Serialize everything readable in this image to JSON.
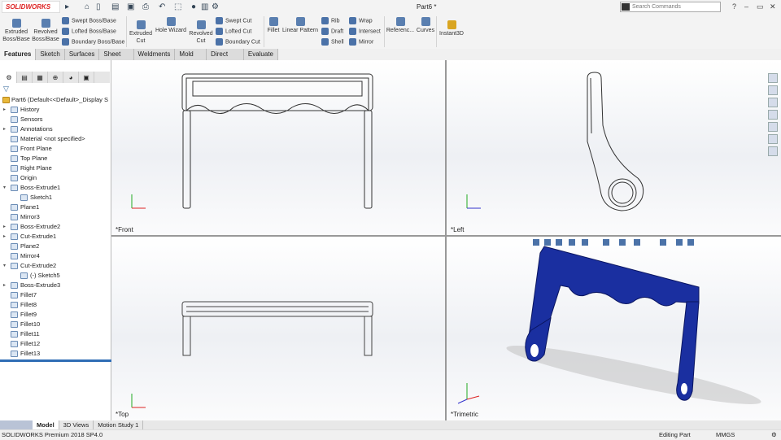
{
  "app": {
    "logo": "SOLIDWORKS",
    "doc_title": "Part6 *",
    "search_placeholder": "Search Commands"
  },
  "ribbon": {
    "extruded_boss": "Extruded Boss/Base",
    "revolved_boss": "Revolved Boss/Base",
    "swept_boss": "Swept Boss/Base",
    "lofted_boss": "Lofted Boss/Base",
    "boundary_boss": "Boundary Boss/Base",
    "extruded_cut": "Extruded Cut",
    "hole_wizard": "Hole Wizard",
    "revolved_cut": "Revolved Cut",
    "swept_cut": "Swept Cut",
    "lofted_cut": "Lofted Cut",
    "boundary_cut": "Boundary Cut",
    "fillet": "Fillet",
    "linear_pattern": "Linear Pattern",
    "rib": "Rib",
    "draft": "Draft",
    "shell": "Shell",
    "wrap": "Wrap",
    "intersect": "Intersect",
    "mirror": "Mirror",
    "reference": "Referenc...",
    "curves": "Curves",
    "instant3d": "Instant3D"
  },
  "tabs": [
    "Features",
    "Sketch",
    "Surfaces",
    "Sheet Metal",
    "Weldments",
    "Mold Tools",
    "Direct Editing",
    "Evaluate"
  ],
  "tree": {
    "root": "Part6  (Default<<Default>_Display S",
    "items": [
      {
        "label": "History",
        "arrow": "▸",
        "indent": 0
      },
      {
        "label": "Sensors",
        "arrow": "",
        "indent": 0
      },
      {
        "label": "Annotations",
        "arrow": "▸",
        "indent": 0
      },
      {
        "label": "Material <not specified>",
        "arrow": "",
        "indent": 0
      },
      {
        "label": "Front Plane",
        "arrow": "",
        "indent": 0
      },
      {
        "label": "Top Plane",
        "arrow": "",
        "indent": 0
      },
      {
        "label": "Right Plane",
        "arrow": "",
        "indent": 0
      },
      {
        "label": "Origin",
        "arrow": "",
        "indent": 0
      },
      {
        "label": "Boss-Extrude1",
        "arrow": "▾",
        "indent": 0
      },
      {
        "label": "Sketch1",
        "arrow": "",
        "indent": 1
      },
      {
        "label": "Plane1",
        "arrow": "",
        "indent": 0
      },
      {
        "label": "Mirror3",
        "arrow": "",
        "indent": 0
      },
      {
        "label": "Boss-Extrude2",
        "arrow": "▸",
        "indent": 0
      },
      {
        "label": "Cut-Extrude1",
        "arrow": "▸",
        "indent": 0
      },
      {
        "label": "Plane2",
        "arrow": "",
        "indent": 0
      },
      {
        "label": "Mirror4",
        "arrow": "",
        "indent": 0
      },
      {
        "label": "Cut-Extrude2",
        "arrow": "▾",
        "indent": 0
      },
      {
        "label": "(-) Sketch5",
        "arrow": "",
        "indent": 1
      },
      {
        "label": "Boss-Extrude3",
        "arrow": "▸",
        "indent": 0
      },
      {
        "label": "Fillet7",
        "arrow": "",
        "indent": 0
      },
      {
        "label": "Fillet8",
        "arrow": "",
        "indent": 0
      },
      {
        "label": "Fillet9",
        "arrow": "",
        "indent": 0
      },
      {
        "label": "Fillet10",
        "arrow": "",
        "indent": 0
      },
      {
        "label": "Fillet11",
        "arrow": "",
        "indent": 0
      },
      {
        "label": "Fillet12",
        "arrow": "",
        "indent": 0
      },
      {
        "label": "Fillet13",
        "arrow": "",
        "indent": 0
      }
    ]
  },
  "views": {
    "front": "*Front",
    "left": "*Left",
    "top": "*Top",
    "trimetric": "*Trimetric"
  },
  "bottom_tabs": [
    "Model",
    "3D Views",
    "Motion Study 1"
  ],
  "status": {
    "product": "SOLIDWORKS Premium 2018 SP4.0",
    "mode": "Editing Part",
    "units": "MMGS"
  },
  "colors": {
    "part": "#1a2fa0",
    "accent": "#d22"
  }
}
